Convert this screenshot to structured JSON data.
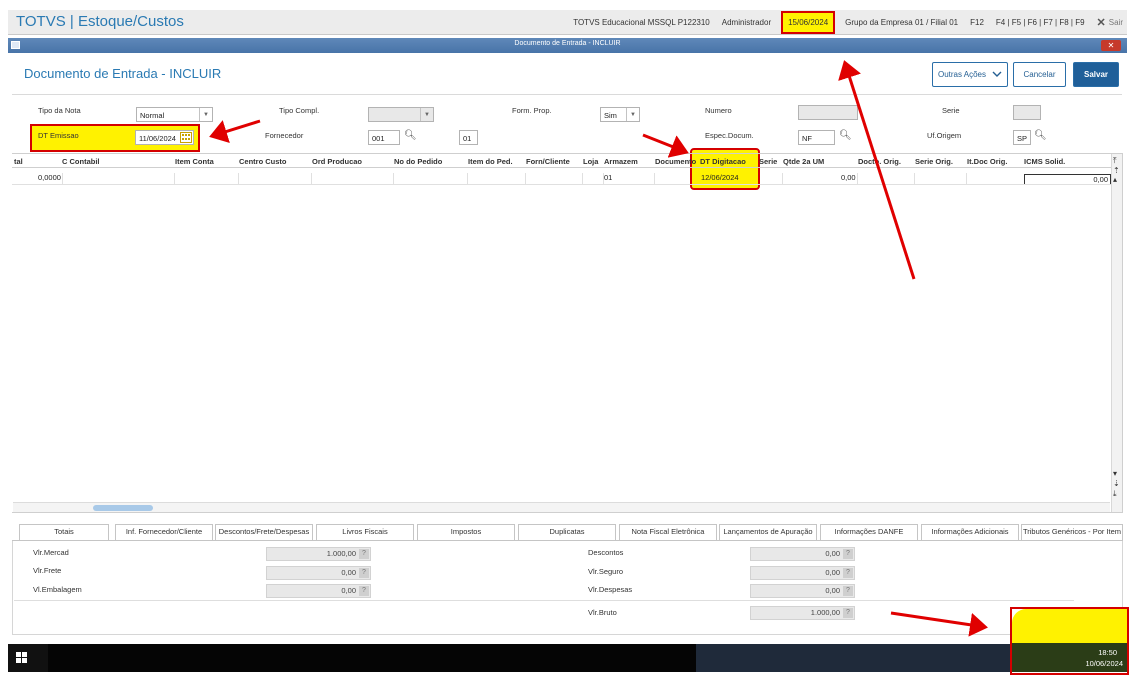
{
  "app": {
    "title": "TOTVS | Estoque/Custos",
    "environment": "TOTVS Educacional MSSQL P122310",
    "user": "Administrador",
    "date": "15/06/2024",
    "company": "Grupo da Empresa 01 / Filial 01",
    "shortcut_f12": "F12",
    "shortcuts": "F4 | F5 | F6 | F7 | F8 | F9",
    "logout_label": "Sair"
  },
  "window": {
    "title": "Documento de Entrada - INCLUIR",
    "heading": "Documento de Entrada - INCLUIR"
  },
  "actions": {
    "more_label": "Outras Ações",
    "cancel_label": "Cancelar",
    "save_label": "Salvar"
  },
  "form": {
    "tipo_nota_label": "Tipo da Nota",
    "tipo_nota_value": "Normal",
    "tipo_compl_label": "Tipo Compl.",
    "form_prop_label": "Form. Prop.",
    "form_prop_value": "Sim",
    "numero_label": "Numero",
    "serie_label": "Serie",
    "dt_emissao_label": "DT Emissao",
    "dt_emissao_value": "11/06/2024",
    "fornecedor_label": "Fornecedor",
    "fornecedor_code": "001",
    "fornecedor_loja": "01",
    "espec_label": "Espec.Docum.",
    "espec_value": "NF",
    "uf_label": "Uf.Origem",
    "uf_value": "SP"
  },
  "grid": {
    "columns": [
      "tal",
      "C Contabil",
      "Item Conta",
      "Centro Custo",
      "Ord Producao",
      "No do Pedido",
      "Item do Ped.",
      "Forn/Cliente",
      "Loja",
      "Armazem",
      "Documento",
      "DT Digitacao",
      "Serie",
      "Qtde 2a UM",
      "Docto. Orig.",
      "Serie Orig.",
      "It.Doc Orig.",
      "ICMS Solid."
    ],
    "row": {
      "total": "0,0000",
      "armazem": "01",
      "dt_digitacao": "12/06/2024",
      "qtde_2a_um": "0,00",
      "icms_solid": "0,00"
    }
  },
  "tabs": [
    "Totais",
    "Inf. Fornecedor/Cliente",
    "Descontos/Frete/Despesas",
    "Livros Fiscais",
    "Impostos",
    "Duplicatas",
    "Nota Fiscal Eletrônica",
    "Lançamentos de Apuração",
    "Informações DANFE",
    "Informações Adicionais",
    "Tributos Genéricos - Por Item"
  ],
  "totals": {
    "vlr_mercad_label": "Vlr.Mercad",
    "vlr_mercad_value": "1.000,00",
    "vlr_frete_label": "Vlr.Frete",
    "vlr_frete_value": "0,00",
    "vl_embalagem_label": "Vl.Embalagem",
    "vl_embalagem_value": "0,00",
    "descontos_label": "Descontos",
    "descontos_value": "0,00",
    "vlr_seguro_label": "Vlr.Seguro",
    "vlr_seguro_value": "0,00",
    "vlr_despesas_label": "Vlr.Despesas",
    "vlr_despesas_value": "0,00",
    "vlr_bruto_label": "Vlr.Bruto",
    "vlr_bruto_value": "1.000,00"
  },
  "taskbar": {
    "time": "18:50",
    "date": "10/06/2024"
  },
  "colors": {
    "accent": "#2a7ab3",
    "highlight": "#fff200",
    "annotation": "#d40000"
  }
}
